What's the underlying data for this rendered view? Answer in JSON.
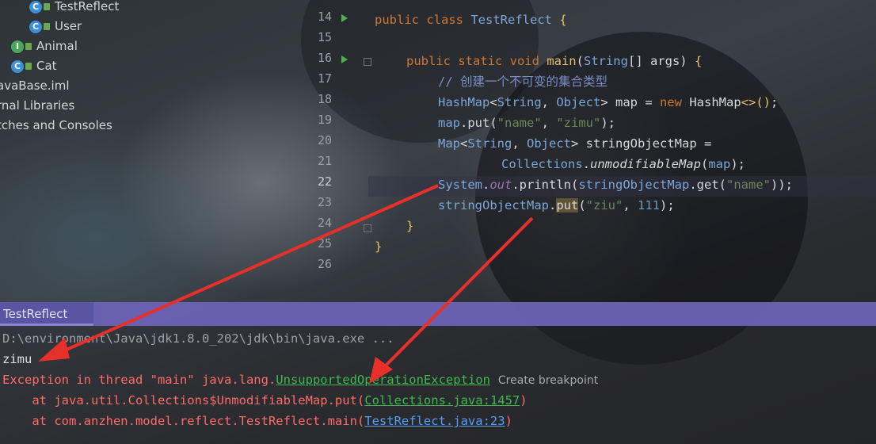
{
  "project_tree": {
    "items": [
      {
        "label": "TestReflect",
        "icon": "class-icon",
        "locked": true
      },
      {
        "label": "User",
        "icon": "class-icon",
        "locked": true
      },
      {
        "label": "Animal",
        "icon": "interface-icon",
        "locked": false
      },
      {
        "label": "Cat",
        "icon": "class-icon",
        "locked": true
      },
      {
        "label": "avaBase.iml"
      },
      {
        "label": "rnal Libraries"
      },
      {
        "label": "tches and Consoles"
      }
    ]
  },
  "editor": {
    "line_numbers": [
      "14",
      "15",
      "16",
      "17",
      "18",
      "19",
      "20",
      "21",
      "22",
      "23",
      "24",
      "25",
      "26"
    ],
    "current_line": "22",
    "comment": "// 创建一个不可变的集合类型"
  },
  "run_panel": {
    "tab_label": "TestReflect",
    "console": {
      "command": "D:\\environment\\Java\\jdk1.8.0_202\\jdk\\bin\\java.exe ...",
      "output": "zimu",
      "exception_prefix": "Exception in thread \"main\" java.lang.",
      "exception_class": "UnsupportedOperationException",
      "tooltip": "Create breakpoint",
      "trace1_prefix": "    at java.util.Collections$UnmodifiableMap.put(",
      "trace1_link": "Collections.java:1457",
      "trace2_prefix": "    at com.anzhen.model.reflect.TestReflect.main(",
      "trace2_link": "TestReflect.java:23",
      "close_paren": ")"
    }
  },
  "colors": {
    "error": "#ff6b68",
    "link_green": "#3fb950",
    "link_blue": "#589df6",
    "annotation_arrow": "#e8302a"
  }
}
